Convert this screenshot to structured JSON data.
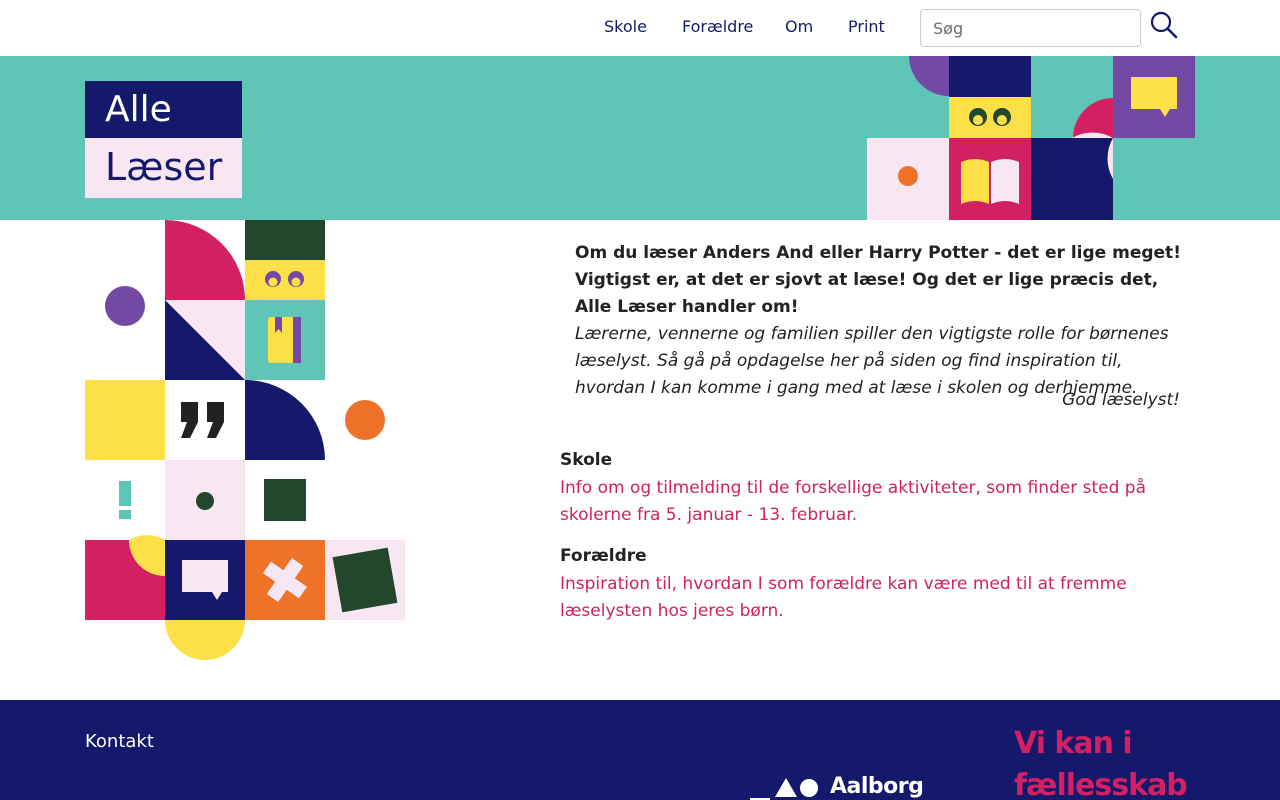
{
  "nav": {
    "links": [
      "Skole",
      "Forældre",
      "Om",
      "Print"
    ],
    "search_placeholder": "Søg"
  },
  "logo": {
    "line1": "Alle",
    "line2": "Læser"
  },
  "intro": {
    "bold": "Om du læser Anders And eller Harry Potter - det er lige meget! Vigtigst er, at det er sjovt at læse! Og det er lige præcis det, Alle Læser handler om!",
    "italic": "Lærerne, vennerne og familien spiller den vigtigste rolle for børnenes læselyst. Så gå på opdagelse her på siden og find inspiration til, hvordan I kan komme i gang med at læse i skolen og derhjemme.",
    "signoff": "God læselyst!"
  },
  "sections": [
    {
      "title": "Skole",
      "link": "Info om og tilmelding til de forskellige aktiviteter, som finder sted på skolerne fra 5. januar - 13. februar."
    },
    {
      "title": "Forældre",
      "link": "Inspiration til, hvordan I som forældre kan være med til at fremme læselysten hos jeres børn."
    }
  ],
  "footer": {
    "contact": "Kontakt",
    "aalborg_logo_text": "Aalborg",
    "slogan_line1": "Vi kan i",
    "slogan_line2": "fællesskab"
  },
  "colors": {
    "navy": "#15196b",
    "teal": "#5ec5b7",
    "pink": "#d22062",
    "purple": "#7448a5",
    "yellow": "#fde047",
    "lightpink": "#f9e6f3",
    "orange": "#ee7328",
    "darkgreen": "#22472d"
  },
  "icons": [
    "search-icon",
    "eyes-icon",
    "book-icon",
    "speech-bubble-icon",
    "quote-icon",
    "exclamation-icon",
    "cross-icon"
  ]
}
